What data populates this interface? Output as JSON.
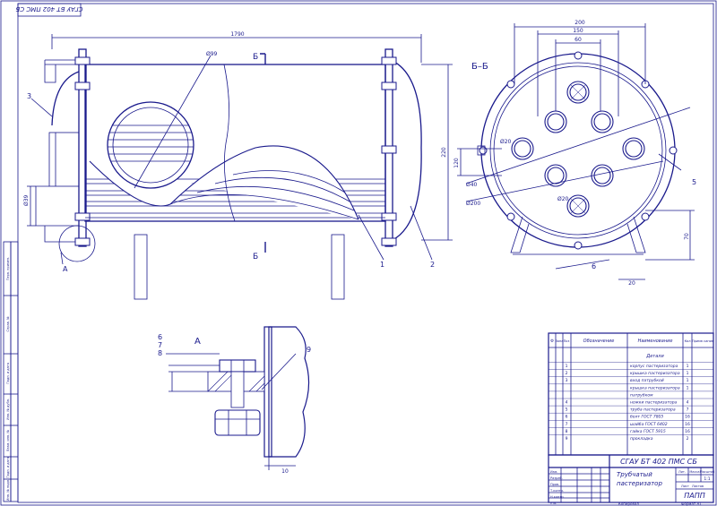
{
  "colors": {
    "line": "#1a1a8c",
    "paper": "#ffffff"
  },
  "stamp_rotated": "СГАУ БТ 402 ПМС СБ",
  "main_view": {
    "dim_length": "1790",
    "dim_height": "220",
    "dim_pipe": "Ø99",
    "dim_inlet": "Ø39",
    "section_mark": "Б",
    "callouts": {
      "c3": "3",
      "c1": "1",
      "c2": "2",
      "cA": "А"
    }
  },
  "section_view": {
    "title": "Б–Б",
    "dim_200": "200",
    "dim_150": "150",
    "dim_60": "60",
    "dim_120": "120",
    "dim_d40": "Ø40",
    "dim_d200": "Ø200",
    "dim_d20a": "Ø20",
    "dim_d20b": "Ø20",
    "dim_70": "70",
    "dim_20": "20",
    "callout_5": "5",
    "callout_6": "6"
  },
  "detail_view": {
    "title": "А",
    "callout_6": "6",
    "callout_7": "7",
    "callout_8": "8",
    "callout_9": "9",
    "dim_10": "10"
  },
  "spec_table": {
    "headers": {
      "fmt": "Ф",
      "zone": "Зона",
      "pos": "Поз",
      "designation": "Обозначение",
      "name": "Наименование",
      "qty": "Кол",
      "note": "Приме-чание"
    },
    "section": "Детали",
    "rows": [
      {
        "pos": "1",
        "name": "корпус пастеризатора",
        "qty": "1"
      },
      {
        "pos": "2",
        "name": "крышка пастеризатора",
        "qty": "1"
      },
      {
        "pos": "3",
        "name": "вход патрубкой",
        "qty": "1"
      },
      {
        "pos": "",
        "name": "крышка пастеризатора",
        "qty": "1"
      },
      {
        "pos": "",
        "name": "патрубком",
        "qty": ""
      },
      {
        "pos": "4",
        "name": "ножки пастеризатора",
        "qty": "4"
      },
      {
        "pos": "5",
        "name": "труба пастеризатора",
        "qty": "7"
      },
      {
        "pos": "6",
        "name": "болт ГОСТ 7805",
        "qty": "16"
      },
      {
        "pos": "7",
        "name": "шайба ГОСТ 6402",
        "qty": "16"
      },
      {
        "pos": "8",
        "name": "гайка ГОСТ 5915",
        "qty": "16"
      },
      {
        "pos": "9",
        "name": "прокладка",
        "qty": "2"
      }
    ]
  },
  "title_block": {
    "code": "СГАУ БТ 402 ПМС СБ",
    "name_line1": "Трубчатый",
    "name_line2": "пастеризатор",
    "lit_label": "Лит.",
    "mass_label": "Масса",
    "scale_label": "Масштаб",
    "scale_value": "1:1",
    "sheet_label": "Лист",
    "sheets_label": "Листов",
    "org": "ПАПП",
    "copied": "Копировал",
    "format": "Формат A1",
    "rows": [
      "Изм.",
      "Разраб.",
      "Пров.",
      "Т.контр.",
      "Н.контр.",
      "Утв."
    ]
  },
  "side_strip": {
    "labels": [
      "Перв. примен.",
      "Справ. №",
      "Подп. и дата",
      "Инв. № дубл.",
      "Взам. инв. №",
      "Подп. и дата",
      "Инв. № подл."
    ]
  }
}
